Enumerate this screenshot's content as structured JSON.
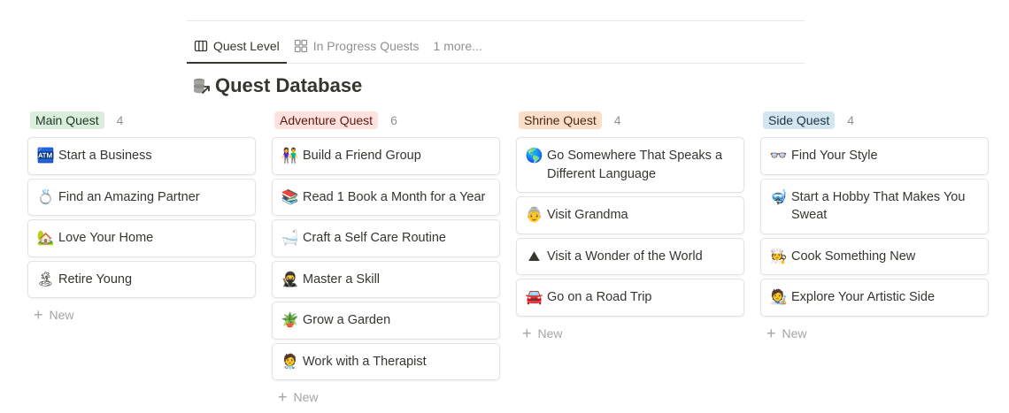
{
  "tabs": [
    {
      "label": "Quest Level",
      "icon": "board-icon",
      "active": true
    },
    {
      "label": "In Progress Quests",
      "icon": "gallery-icon",
      "active": false
    }
  ],
  "more_tabs_label": "1 more...",
  "database_title": "Quest Database",
  "new_label": "New",
  "columns": [
    {
      "name": "Main Quest",
      "count": "4",
      "pill_bg": "#dbeddb",
      "pill_fg": "#1c3829",
      "cards": [
        {
          "emoji": "🏧",
          "label": "Start a Business"
        },
        {
          "emoji": "💍",
          "label": "Find an Amazing Partner"
        },
        {
          "emoji": "🏡",
          "label": "Love Your Home"
        },
        {
          "emoji": "🏝",
          "label": "Retire Young"
        }
      ]
    },
    {
      "name": "Adventure Quest",
      "count": "6",
      "pill_bg": "#ffe2dd",
      "pill_fg": "#5d1715",
      "cards": [
        {
          "emoji": "👫",
          "label": "Build a Friend Group"
        },
        {
          "emoji": "📚",
          "label": "Read 1 Book a Month for a Year"
        },
        {
          "emoji": "🛁",
          "label": "Craft a Self Care Routine"
        },
        {
          "emoji": "🥷",
          "label": "Master a Skill"
        },
        {
          "emoji": "🪴",
          "label": "Grow a Garden"
        },
        {
          "emoji": "🧑‍⚕️",
          "label": "Work with a Therapist"
        }
      ]
    },
    {
      "name": "Shrine Quest",
      "count": "4",
      "pill_bg": "#fadec9",
      "pill_fg": "#49290e",
      "cards": [
        {
          "emoji": "🌎",
          "label": "Go Somewhere That Speaks a Different Language"
        },
        {
          "emoji": "👵",
          "label": "Visit Grandma"
        },
        {
          "emoji": "⛰",
          "label": "Visit a Wonder of the World"
        },
        {
          "emoji": "🚘",
          "label": "Go on a Road Trip"
        }
      ]
    },
    {
      "name": "Side Quest",
      "count": "4",
      "pill_bg": "#d3e5ef",
      "pill_fg": "#183347",
      "cards": [
        {
          "emoji": "👓",
          "label": "Find Your Style"
        },
        {
          "emoji": "🤿",
          "label": "Start a Hobby That Makes You Sweat"
        },
        {
          "emoji": "🧑‍🍳",
          "label": "Cook Something New"
        },
        {
          "emoji": "🧑‍🎨",
          "label": "Explore Your Artistic Side"
        }
      ]
    }
  ]
}
